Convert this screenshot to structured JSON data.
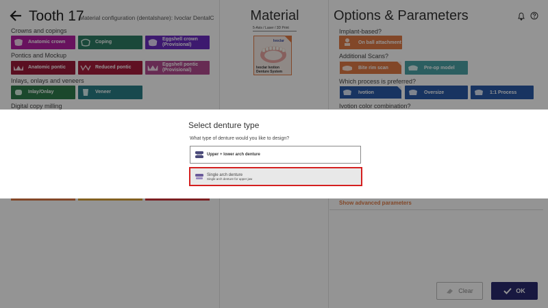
{
  "header": {
    "title": "Tooth 17",
    "material_config": "Material configuration (dentalshare): Ivoclar DentalCAD Ma"
  },
  "left": {
    "sections": [
      {
        "label": "Crowns and copings"
      },
      {
        "label": "Pontics and Mockup"
      },
      {
        "label": "Inlays, onlays and veneers"
      },
      {
        "label": "Digital copy milling"
      }
    ],
    "tiles": {
      "anatomic_crown": "Anatomic crown",
      "coping": "Coping",
      "eggshell_crown": "Eggshell crown (Provisional)",
      "anatomic_pontic": "Anatomic pontic",
      "reduced_pontic": "Reduced pontic",
      "eggshell_pontic": "Eggshell pontic (Provisional)",
      "inlay_onlay": "Inlay/Onlay",
      "veneer": "Veneer"
    },
    "colors": {
      "crown": "#b31fa3",
      "coping": "#2e7d65",
      "eggshell_crown": "#6a2bc0",
      "pontic": "#9b1b3a",
      "reduced_pontic": "#a61d3c",
      "eggshell_pontic": "#b24a8f",
      "inlay": "#2f7d4c",
      "veneer": "#2a7f87"
    }
  },
  "middle": {
    "title": "Material",
    "process_select": "5-Axis / Laser / 3D Print",
    "material_card": {
      "brand": "Ivoclar",
      "name_line1": "Ivoclar Ivotion",
      "name_line2": "Denture System"
    }
  },
  "right": {
    "title": "Options & Parameters",
    "q_implant": "Implant-based?",
    "on_ball_attachment": "On ball attachment",
    "q_scans": "Additional Scans?",
    "bite_rim_scan": "Bite rim scan",
    "pre_op_model": "Pre-op model",
    "q_process": "Which process is preferred?",
    "ivotion": "Ivotion",
    "oversize": "Oversize",
    "process_1_1": "1:1 Process",
    "q_color": "Ivotion color combination?",
    "advanced_link": "Show advanced parameters",
    "clear_label": "Clear",
    "ok_label": "OK",
    "colors": {
      "orange": "#e07a45",
      "teal": "#4ba3a6",
      "blue": "#2a5aa8",
      "dark_button": "#2a2a6e"
    }
  },
  "dialog": {
    "title": "Select denture type",
    "subtitle": "What type of denture would you like to design?",
    "options": [
      {
        "label": "Upper + lower arch denture",
        "description": ""
      },
      {
        "label": "Single arch denture",
        "description": "Single arch denture for upper jaw",
        "selected": true
      }
    ],
    "highlight_color": "#d41e1e"
  }
}
